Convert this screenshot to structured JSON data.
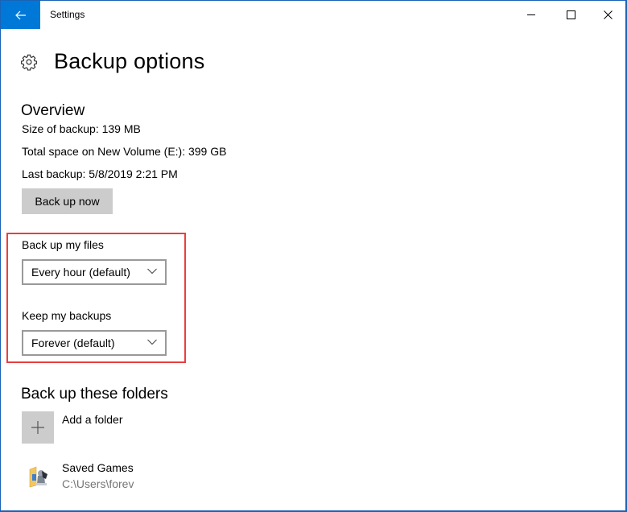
{
  "window": {
    "title": "Settings",
    "back_icon": "arrow-left-icon",
    "controls": {
      "minimize": "minimize-icon",
      "maximize": "maximize-icon",
      "close": "close-icon"
    }
  },
  "page": {
    "icon": "gear-icon",
    "title": "Backup options"
  },
  "overview": {
    "title": "Overview",
    "size_of_backup": "Size of backup: 139 MB",
    "total_space": "Total space on New Volume (E:): 399 GB",
    "last_backup": "Last backup: 5/8/2019 2:21 PM",
    "back_up_now_label": "Back up now"
  },
  "settings": {
    "backup_frequency": {
      "label": "Back up my files",
      "selected": "Every hour (default)"
    },
    "retention": {
      "label": "Keep my backups",
      "selected": "Forever (default)"
    },
    "highlight_color": "#e8403f"
  },
  "folders": {
    "title": "Back up these folders",
    "add_label": "Add a folder",
    "items": [
      {
        "name": "Saved Games",
        "path": "C:\\Users\\forev",
        "icon": "saved-games-folder-icon"
      }
    ]
  },
  "colors": {
    "accent": "#0078d7",
    "button_bg": "#cccccc",
    "border": "#1a62b6"
  }
}
